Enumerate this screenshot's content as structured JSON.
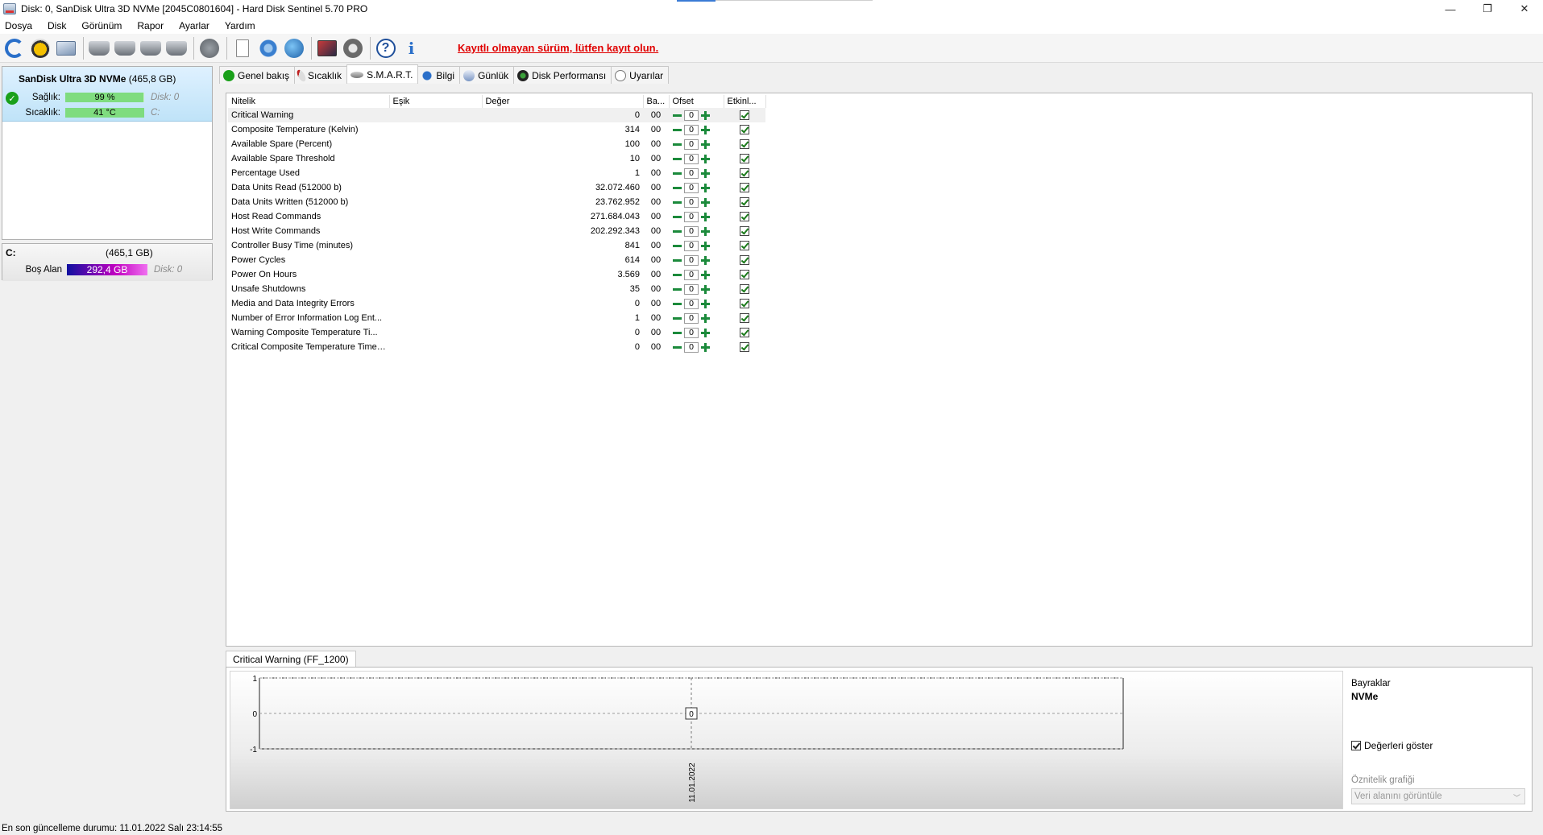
{
  "window": {
    "title": "Disk: 0, SanDisk Ultra 3D NVMe [2045C0801604]  -  Hard Disk Sentinel 5.70 PRO",
    "minimize": "—",
    "restore": "❐",
    "close": "✕"
  },
  "menu": [
    "Dosya",
    "Disk",
    "Görünüm",
    "Rapor",
    "Ayarlar",
    "Yardım"
  ],
  "toolbar": {
    "unregistered_notice": "Kayıtlı olmayan sürüm, lütfen kayıt olun."
  },
  "disk": {
    "name": "SanDisk Ultra 3D NVMe",
    "size": "(465,8 GB)",
    "health_label": "Sağlık:",
    "health_value": "99 %",
    "health_percent": 99,
    "health_side": "Disk: 0",
    "temp_label": "Sıcaklık:",
    "temp_value": "41 °C",
    "temp_side": "C:"
  },
  "volume": {
    "letter": "C:",
    "size": "(465,1 GB)",
    "free_label": "Boş Alan",
    "free_value": "292,4 GB",
    "side": "Disk: 0"
  },
  "tabs": [
    {
      "label": "Genel bakış",
      "icon": "ok"
    },
    {
      "label": "Sıcaklık",
      "icon": "temp"
    },
    {
      "label": "S.M.A.R.T.",
      "icon": "smart"
    },
    {
      "label": "Bilgi",
      "icon": "info"
    },
    {
      "label": "Günlük",
      "icon": "log"
    },
    {
      "label": "Disk Performansı",
      "icon": "perf"
    },
    {
      "label": "Uyarılar",
      "icon": "warn"
    }
  ],
  "smart": {
    "headers": [
      "Nitelik",
      "Eşik",
      "Değer",
      "Ba...",
      "Ofset",
      "Etkinl..."
    ],
    "rows": [
      {
        "name": "Critical Warning",
        "value": "0",
        "worst": "00",
        "offset": "0"
      },
      {
        "name": "Composite Temperature (Kelvin)",
        "value": "314",
        "worst": "00",
        "offset": "0"
      },
      {
        "name": "Available Spare (Percent)",
        "value": "100",
        "worst": "00",
        "offset": "0"
      },
      {
        "name": "Available Spare Threshold",
        "value": "10",
        "worst": "00",
        "offset": "0"
      },
      {
        "name": "Percentage Used",
        "value": "1",
        "worst": "00",
        "offset": "0"
      },
      {
        "name": "Data Units Read (512000 b)",
        "value": "32.072.460",
        "worst": "00",
        "offset": "0"
      },
      {
        "name": "Data Units Written (512000 b)",
        "value": "23.762.952",
        "worst": "00",
        "offset": "0"
      },
      {
        "name": "Host Read Commands",
        "value": "271.684.043",
        "worst": "00",
        "offset": "0"
      },
      {
        "name": "Host Write Commands",
        "value": "202.292.343",
        "worst": "00",
        "offset": "0"
      },
      {
        "name": "Controller Busy Time (minutes)",
        "value": "841",
        "worst": "00",
        "offset": "0"
      },
      {
        "name": "Power Cycles",
        "value": "614",
        "worst": "00",
        "offset": "0"
      },
      {
        "name": "Power On Hours",
        "value": "3.569",
        "worst": "00",
        "offset": "0"
      },
      {
        "name": "Unsafe Shutdowns",
        "value": "35",
        "worst": "00",
        "offset": "0"
      },
      {
        "name": "Media and Data Integrity Errors",
        "value": "0",
        "worst": "00",
        "offset": "0"
      },
      {
        "name": "Number of Error Information Log Ent...",
        "value": "1",
        "worst": "00",
        "offset": "0"
      },
      {
        "name": "Warning Composite Temperature Ti...",
        "value": "0",
        "worst": "00",
        "offset": "0"
      },
      {
        "name": "Critical Composite Temperature Time ...",
        "value": "0",
        "worst": "00",
        "offset": "0"
      }
    ]
  },
  "chart": {
    "tab_label": "Critical Warning (FF_1200)",
    "y_ticks": [
      "1",
      "0",
      "-1"
    ],
    "point_value": "0",
    "x_label": "11.01.2022"
  },
  "chart_data": {
    "type": "line",
    "x": [
      "11.01.2022"
    ],
    "series": [
      {
        "values": [
          0
        ]
      }
    ],
    "ylim": [
      -1,
      1
    ],
    "yticks": [
      1,
      0,
      -1
    ],
    "grid": true
  },
  "chart_side": {
    "flags_label": "Bayraklar",
    "flags_value": "NVMe",
    "show_values": "Değerleri göster",
    "attr_chart_label": "Öznitelik grafiği",
    "attr_chart_select": "Veri alanını görüntüle"
  },
  "status": "En son güncelleme durumu: 11.01.2022 Salı 23:14:55"
}
